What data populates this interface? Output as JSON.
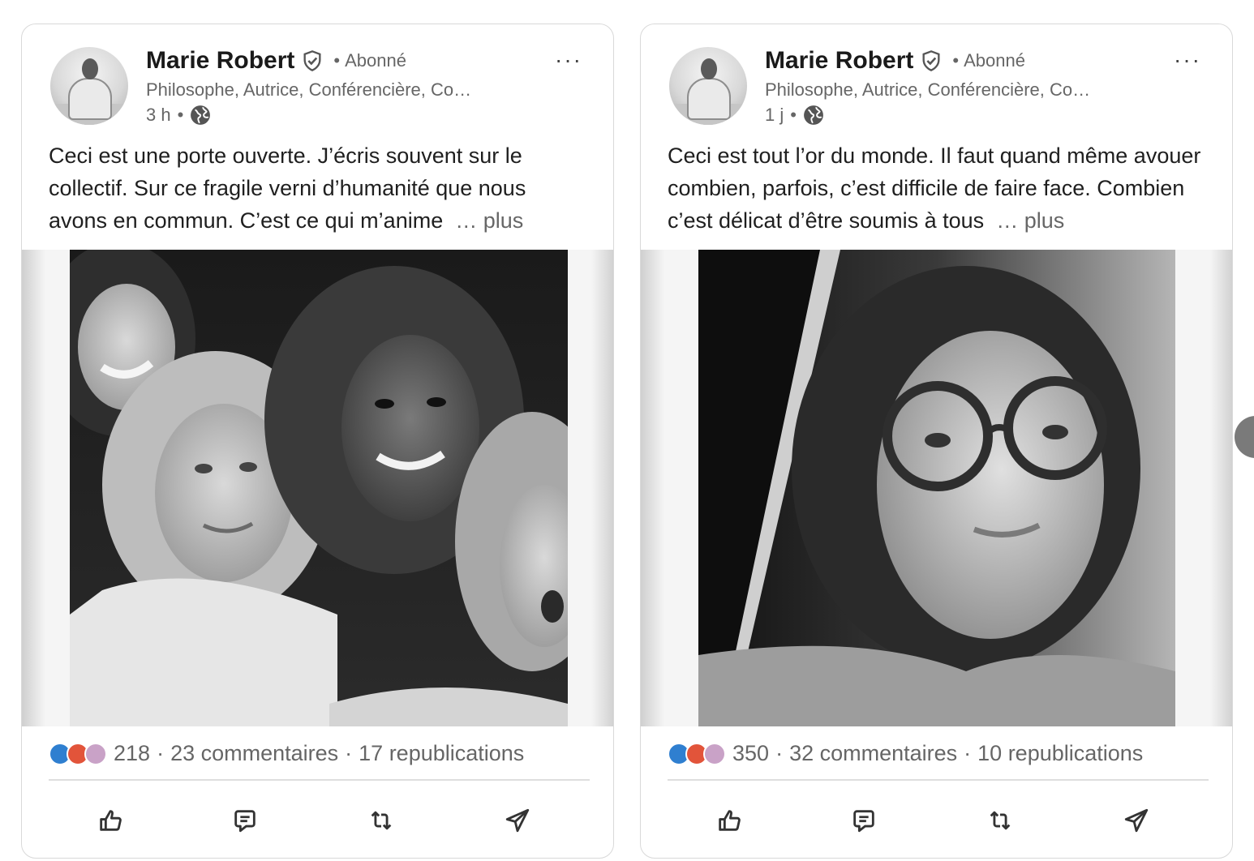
{
  "posts": [
    {
      "author": "Marie Robert",
      "follow_status": "Abonné",
      "dot": "•",
      "headline": "Philosophe, Autrice, Conférencière, Co…",
      "time": "3 h",
      "text": "Ceci est une porte ouverte. J’écris souvent sur le collectif. Sur ce fragile verni d’humanité que nous avons en commun. C’est ce qui m’anime",
      "more_label": "… plus",
      "reactions_count": "218",
      "comments": "23 commentaires",
      "reposts": "17 republications",
      "stat_sep": "·"
    },
    {
      "author": "Marie Robert",
      "follow_status": "Abonné",
      "dot": "•",
      "headline": "Philosophe, Autrice, Conférencière, Co…",
      "time": "1 j",
      "text": "Ceci est tout l’or du monde. Il faut quand même avouer combien, parfois, c’est difficile de faire face. Combien c’est délicat d’être soumis à tous",
      "more_label": "… plus",
      "reactions_count": "350",
      "comments": "32 commentaires",
      "reposts": "10 republications",
      "stat_sep": "·"
    }
  ],
  "icons": {
    "more": "more-horizontal-icon",
    "verified": "verified-shield-icon",
    "visibility": "globe-icon",
    "reactions": [
      "like-reaction-icon",
      "love-reaction-icon",
      "support-reaction-icon"
    ],
    "actions": [
      "like-icon",
      "comment-icon",
      "repost-icon",
      "send-icon"
    ]
  },
  "ui": {
    "more_glyph": "···"
  },
  "colors": {
    "like": "#2f7fd0",
    "love": "#e2543a",
    "support": "#c9a2c7",
    "card_border": "#d9d9d9",
    "secondary_text": "#666666"
  }
}
